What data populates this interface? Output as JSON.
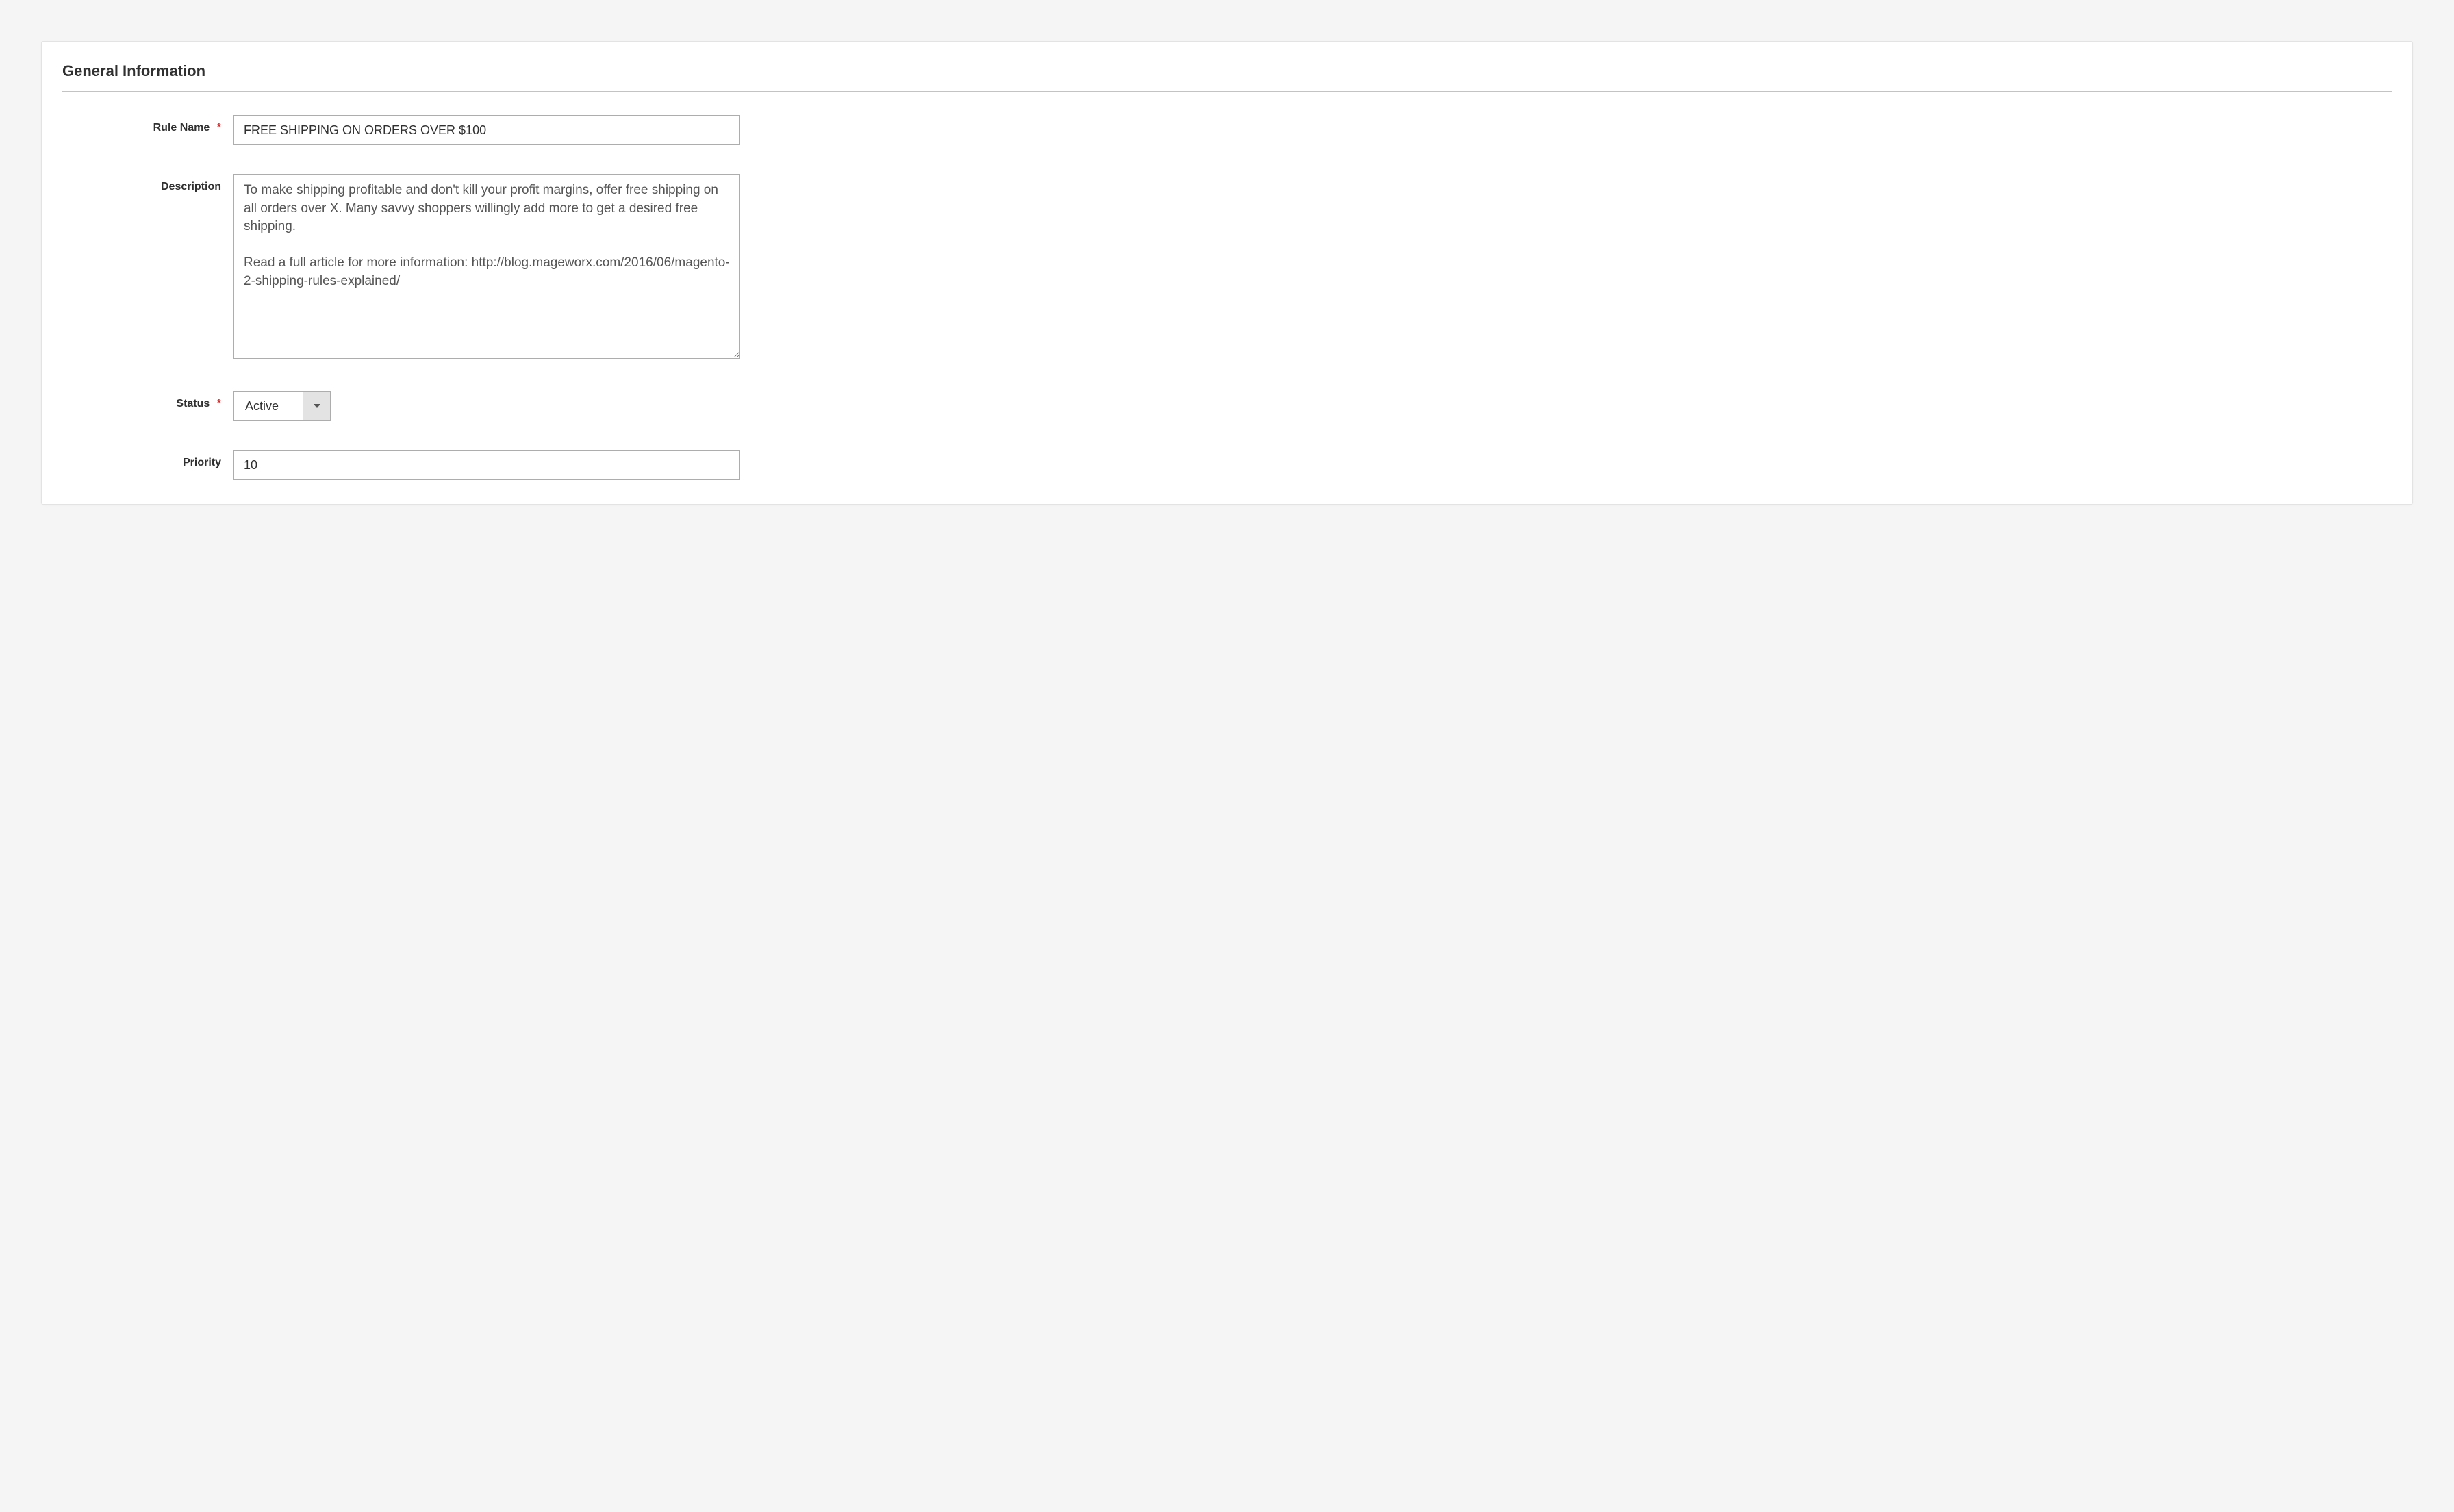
{
  "section": {
    "title": "General Information"
  },
  "fields": {
    "rule_name": {
      "label": "Rule Name",
      "value": "FREE SHIPPING ON ORDERS OVER $100",
      "required_mark": "*"
    },
    "description": {
      "label": "Description",
      "value": "To make shipping profitable and don't kill your profit margins, offer free shipping on all orders over X. Many savvy shoppers willingly add more to get a desired free shipping.\n\nRead a full article for more information: http://blog.mageworx.com/2016/06/magento-2-shipping-rules-explained/"
    },
    "status": {
      "label": "Status",
      "value": "Active",
      "required_mark": "*"
    },
    "priority": {
      "label": "Priority",
      "value": "10"
    }
  }
}
